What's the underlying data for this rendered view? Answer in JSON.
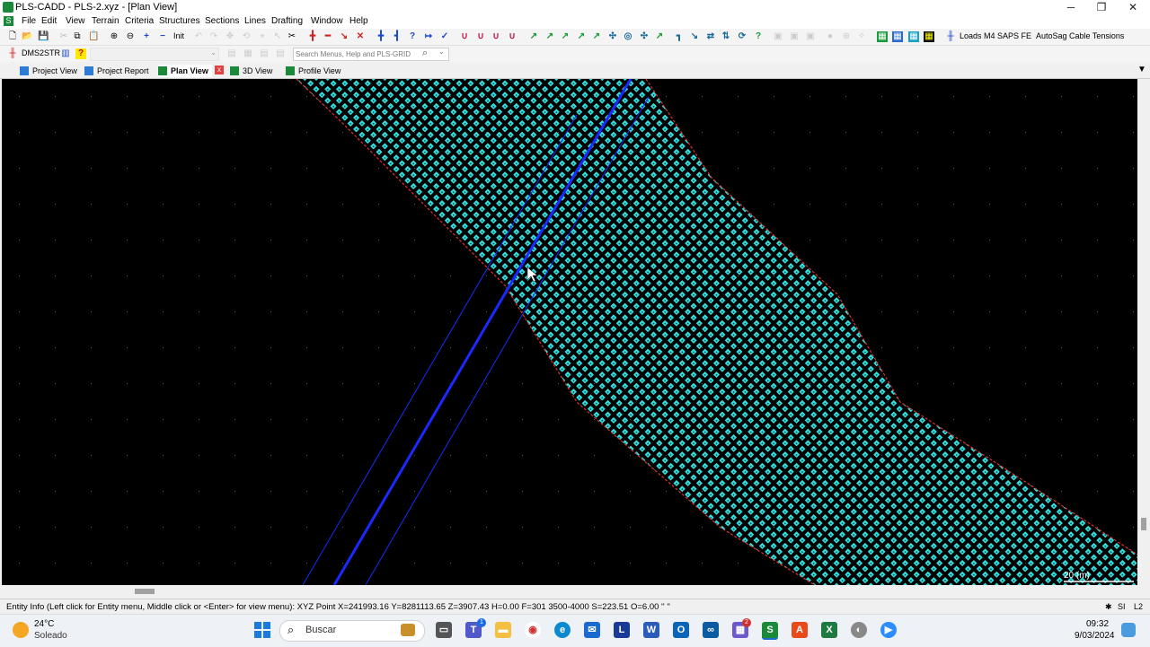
{
  "window": {
    "title": "PLS-CADD - PLS-2.xyz - [Plan View]",
    "minimize": "─",
    "maximize": "❐",
    "close": "✕"
  },
  "menu": [
    "File",
    "Edit",
    "View",
    "Terrain",
    "Criteria",
    "Structures",
    "Sections",
    "Lines",
    "Drafting",
    "Window",
    "Help"
  ],
  "toolbar": {
    "init_label": "Init",
    "loads_label": "Loads M4",
    "saps_label": "SAPS FE",
    "autosag_label": "AutoSag",
    "cable_tensions_label": "Cable Tensions",
    "dms_label": "DMS2STR",
    "help_label": "?"
  },
  "search": {
    "placeholder": "Search Menus, Help and PLS-GRID"
  },
  "tabs": [
    {
      "label": "Project View",
      "color": "#2e7bd6"
    },
    {
      "label": "Project Report",
      "color": "#2e7bd6"
    },
    {
      "label": "Plan View",
      "color": "#1a8a3a"
    },
    {
      "label": "3D View",
      "color": "#1a8a3a"
    },
    {
      "label": "Profile View",
      "color": "#1a8a3a"
    }
  ],
  "tab_close": "x",
  "viewport": {
    "scale_label": "20 (m)",
    "background": "#000000",
    "terrain_color": "#33e0e0",
    "edge_color": "#e03030",
    "line_color": "#1a2aff"
  },
  "status": {
    "text": "Entity Info (Left click for Entity menu, Middle click or <Enter> for view menu):  XYZ Point  X=241993.16 Y=8281113.65 Z=3907.43 H=0.00 F=301 3500-4000 S=223.51 O=6.00 '' ''",
    "units": "SI",
    "layer": "L2"
  },
  "taskbar": {
    "weather_temp": "24°C",
    "weather_desc": "Soleado",
    "search_label": "Buscar",
    "time": "09:32",
    "date": "9/03/2024",
    "teams_badge": "1",
    "app_badge": "2"
  }
}
